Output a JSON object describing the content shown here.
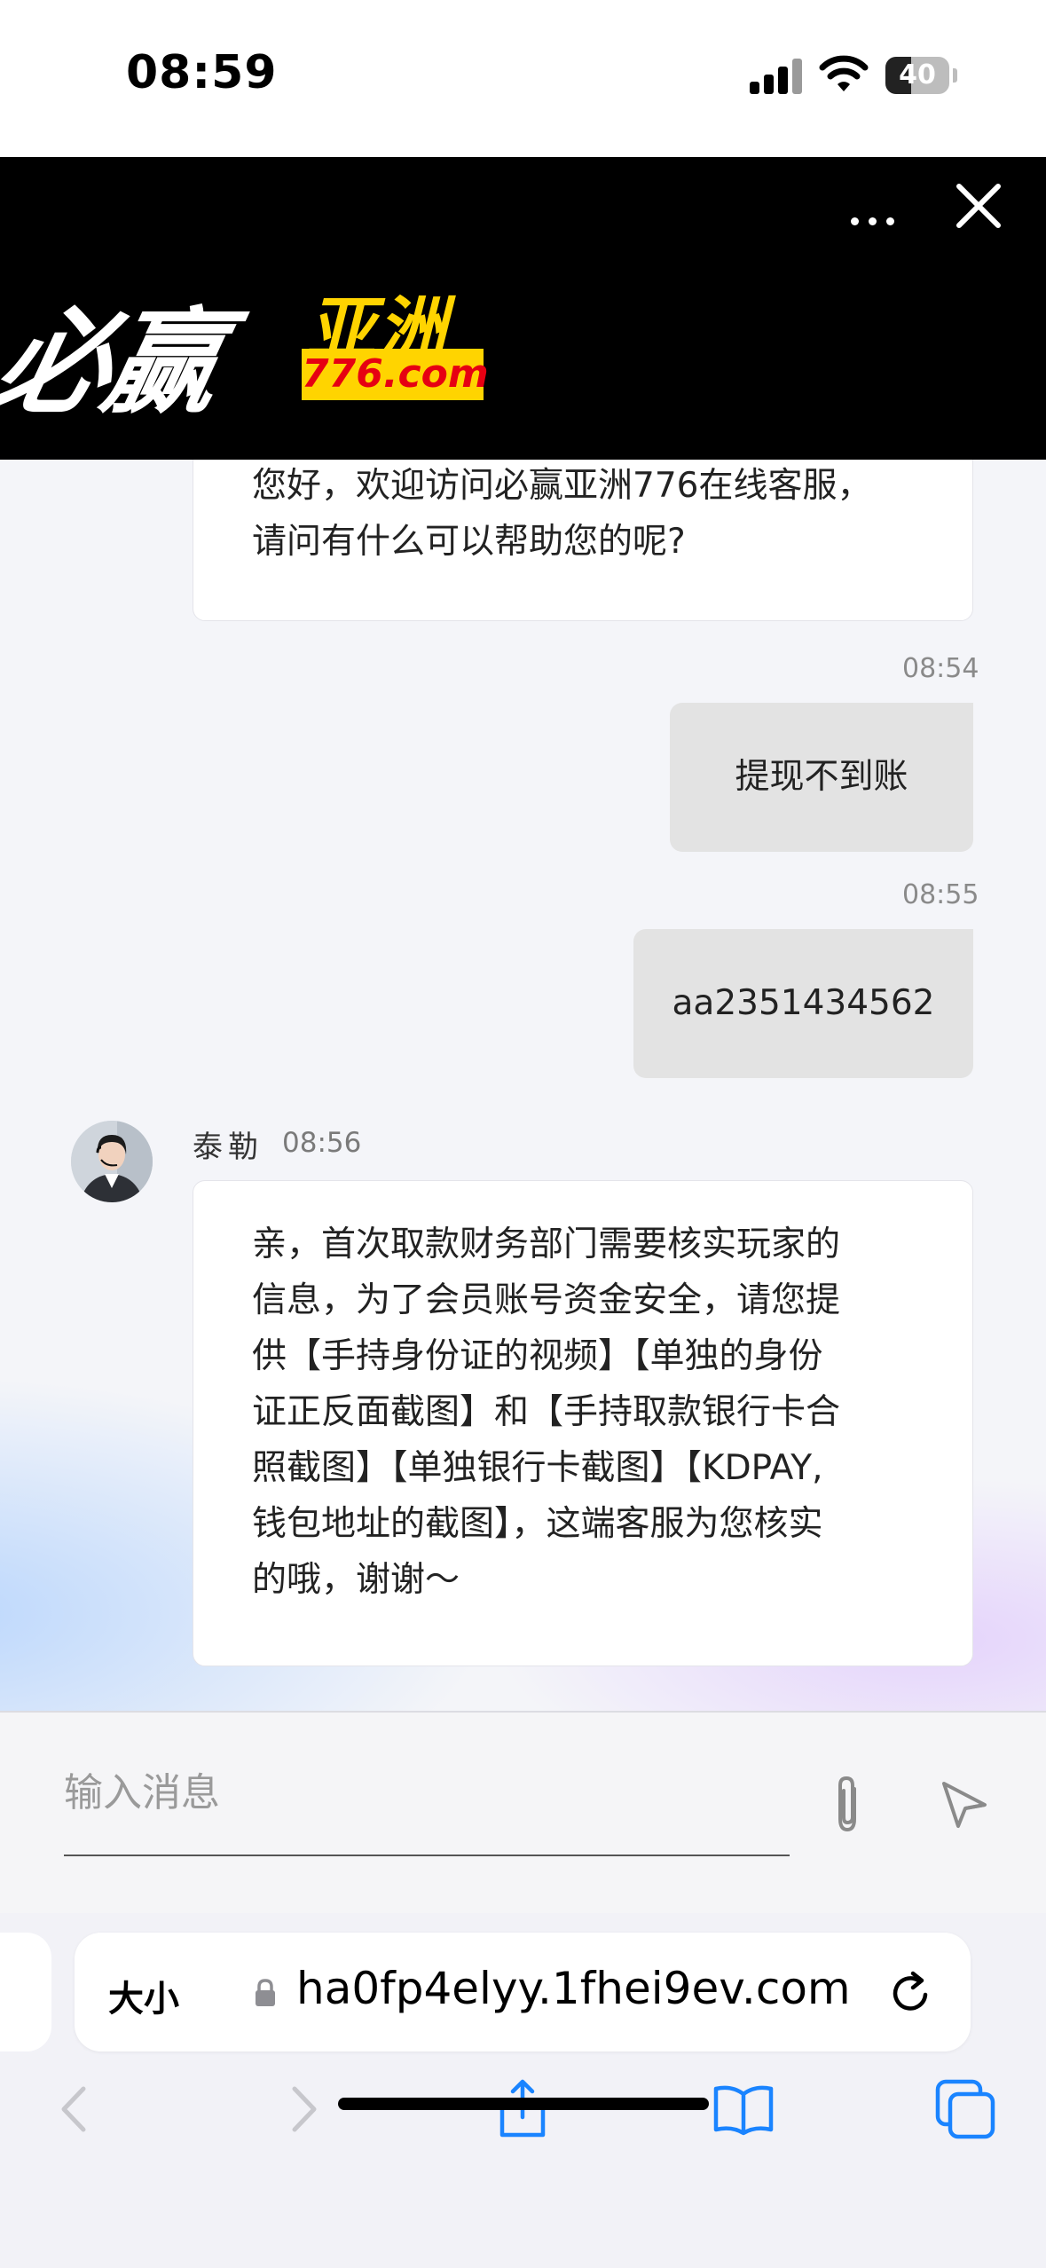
{
  "status_bar": {
    "time": "08:59",
    "battery": "40",
    "battery_level": 0.4
  },
  "banner": {
    "logo_text": "必赢亚洲",
    "logo_chinese": "必赢",
    "logo_brand": "亚洲",
    "logo_domain": "776.com",
    "more_label": "•••",
    "close_label": "✕"
  },
  "messages": {
    "welcome": {
      "line1": "您好，欢迎访问必赢亚洲776在线客服，",
      "line2": "请问有什么可以帮助您的呢?"
    },
    "user1": {
      "time": "08:54",
      "text": "提现不到账"
    },
    "user2": {
      "time": "08:55",
      "text": "aa2351434562"
    },
    "agent": {
      "name": "泰勒",
      "time": "08:56",
      "lines": [
        "亲，首次取款财务部门需要核实玩家的",
        "信息，为了会员账号资金安全，请您提",
        "供【手持身份证的视频】【单独的身份",
        "证正反面截图】和【手持取款银行卡合",
        "照截图】【单独银行卡截图】【KDPAY,",
        "钱包地址的截图】，这端客服为您核实",
        "的哦，谢谢～"
      ]
    }
  },
  "input": {
    "placeholder": "输入消息",
    "value": ""
  },
  "browser": {
    "text_size_label": "大小",
    "url": "ha0fp4elyy.1fhei9ev.com"
  },
  "colors": {
    "accent_blue": "#1a84ff",
    "brand_yellow": "#ffd400",
    "brand_red": "#e60012"
  }
}
